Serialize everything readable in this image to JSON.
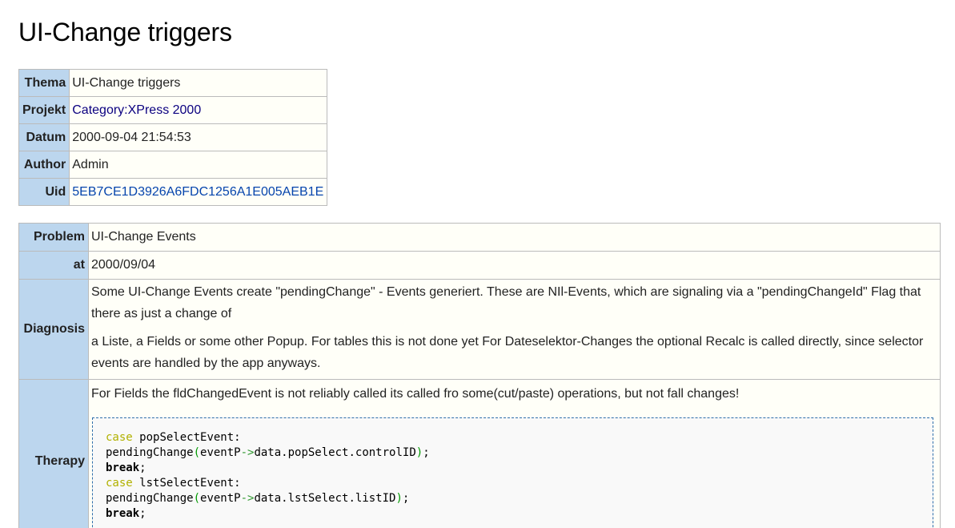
{
  "title": "UI-Change triggers",
  "meta": {
    "thema_label": "Thema",
    "thema_value": "UI-Change triggers",
    "projekt_label": "Projekt",
    "projekt_value": "Category:XPress 2000",
    "datum_label": "Datum",
    "datum_value": "2000-09-04 21:54:53",
    "author_label": "Author",
    "author_value": "Admin",
    "uid_label": "Uid",
    "uid_value": "5EB7CE1D3926A6FDC1256A1E005AEB1E"
  },
  "detail": {
    "problem_label": "Problem",
    "problem_value": "UI-Change Events",
    "at_label": "at",
    "at_value": "2000/09/04",
    "diagnosis_label": "Diagnosis",
    "diagnosis_p1": "Some UI-Change Events create \"pendingChange\" - Events generiert. These are NIl-Events, which are signaling via a \"pendingChangeId\" Flag that there as just a change of",
    "diagnosis_p2": "a Liste, a Fields or some other Popup. For tables this is not done yet For Dateselektor-Changes the optional Recalc is called directly, since selector events are handled by the app anyways.",
    "therapy_label": "Therapy",
    "therapy_text": "For Fields the fldChangedEvent is not reliably called its called fro some(cut/paste) operations, but not fall changes!",
    "code": {
      "kw_case": "case",
      "kw_break": "break",
      "semicolon": ";",
      "colon": ":",
      "paren_open": "(",
      "paren_close": ")",
      "arrow": "->",
      "event_1": "popSelectEvent",
      "call_name": "pendingChange",
      "ptr_name": "eventP",
      "member_1": "data.popSelect.controlID",
      "event_2": "lstSelectEvent",
      "member_2": "data.lstSelect.listID"
    }
  },
  "colors": {
    "label_bg": "#bcd6ee",
    "value_bg": "#fffff8",
    "link": "#0645ad",
    "link_dark": "#0b0080",
    "code_border": "#2f6fab",
    "code_keyword": "#b1b100",
    "code_paren": "#009900"
  }
}
